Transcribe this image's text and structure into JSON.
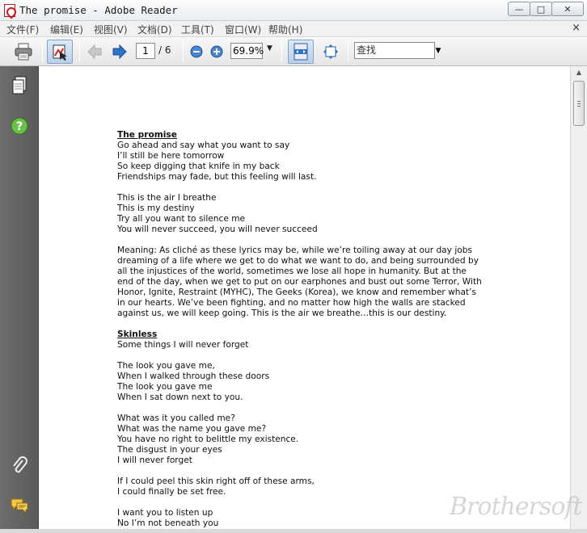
{
  "window": {
    "title": "The promise - Adobe Reader",
    "min": "—",
    "max": "□",
    "close": "✕"
  },
  "menu": {
    "items": [
      "文件(F)",
      "编辑(E)",
      "视图(V)",
      "文档(D)",
      "工具(T)",
      "窗口(W)",
      "帮助(H)"
    ],
    "close": "×"
  },
  "toolbar": {
    "page_current": "1",
    "page_total": "/ 6",
    "zoom": "69.9%",
    "find_placeholder": "查找"
  },
  "document": {
    "lines": [
      {
        "text": "The promise",
        "style": "heading"
      },
      {
        "text": "Go ahead and say what you want to say"
      },
      {
        "text": "I’ll still be here tomorrow"
      },
      {
        "text": "So keep digging that knife in my back"
      },
      {
        "text": "Friendships may fade, but this feeling will last."
      },
      {
        "text": ""
      },
      {
        "text": "This is the air I breathe"
      },
      {
        "text": "This is my destiny"
      },
      {
        "text": "Try all you want to silence me"
      },
      {
        "text": "You will never succeed, you will never succeed"
      },
      {
        "text": ""
      },
      {
        "text": "Meaning: As cliché as these lyrics may be, while we’re toiling away at our day jobs"
      },
      {
        "text": "dreaming of a life where we get to do what we want to do, and being surrounded by"
      },
      {
        "text": "all the injustices of the world, sometimes we lose all hope in humanity. But at the"
      },
      {
        "text": "end of the day, when we get to put on our earphones and bust out some Terror, With"
      },
      {
        "text": "Honor, Ignite, Restraint (MYHC), The Geeks (Korea), we know and remember what’s"
      },
      {
        "text": "in our hearts. We’ve been fighting, and no matter how high the walls are stacked"
      },
      {
        "text": "against us, we will keep going. This is the air we breathe…this is our destiny."
      },
      {
        "text": ""
      },
      {
        "text": "Skinless",
        "style": "heading"
      },
      {
        "text": "Some things I will never forget"
      },
      {
        "text": ""
      },
      {
        "text": "The look you gave me,"
      },
      {
        "text": "When I walked through these doors"
      },
      {
        "text": "The look you gave me"
      },
      {
        "text": "When I sat down next to you."
      },
      {
        "text": ""
      },
      {
        "text": "What was it you called me?"
      },
      {
        "text": "What was the name you gave me?"
      },
      {
        "text": "You have no right to belittle my existence."
      },
      {
        "text": "The disgust in your eyes"
      },
      {
        "text": "I will never forget"
      },
      {
        "text": ""
      },
      {
        "text": "If I could peel this skin right off of these arms,"
      },
      {
        "text": "I could finally be set free."
      },
      {
        "text": ""
      },
      {
        "text": "I want you to listen up"
      },
      {
        "text": "No I’m not beneath you"
      }
    ]
  },
  "watermark": "Brothersoft",
  "colors": {
    "accent_blue": "#2f73c5",
    "nav_green": "#6cc04a",
    "pdf_red": "#c4161c"
  }
}
